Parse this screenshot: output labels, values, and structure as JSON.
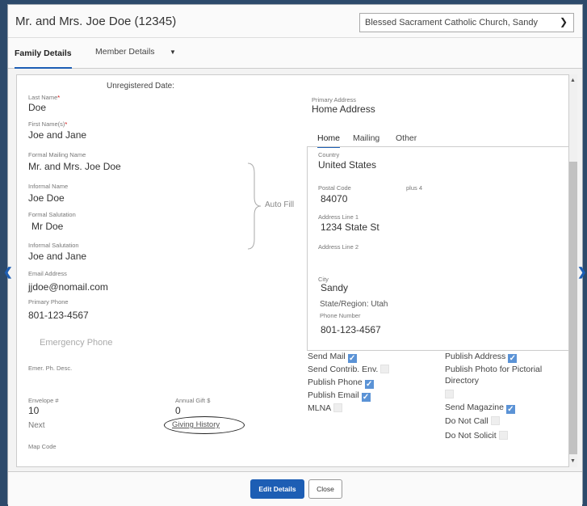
{
  "header": {
    "title": "Mr. and Mrs. Joe Doe (12345)",
    "church": "Blessed Sacrament Catholic Church, Sandy"
  },
  "tabs": {
    "family": "Family Details",
    "member": "Member Details"
  },
  "left": {
    "unregistered_label": "Unregistered Date:",
    "last_name_label": "Last Name",
    "last_name": "Doe",
    "first_name_label": "First Name(s)",
    "first_name": "Joe and Jane",
    "formal_mailing_label": "Formal Mailing Name",
    "formal_mailing": "Mr. and Mrs. Joe Doe",
    "informal_name_label": "Informal Name",
    "informal_name": "Joe Doe",
    "formal_salutation_label": "Formal Salutation",
    "formal_salutation": "Mr Doe",
    "informal_salutation_label": "Informal Salutation",
    "informal_salutation": "Joe and Jane",
    "email_label": "Email Address",
    "email": "jjdoe@nomail.com",
    "primary_phone_label": "Primary Phone",
    "primary_phone": "801-123-4567",
    "emergency_phone_placeholder": "Emergency Phone",
    "emer_desc_label": "Emer. Ph. Desc.",
    "envelope_label": "Envelope #",
    "envelope": "10",
    "annual_gift_label": "Annual Gift $",
    "annual_gift": "0",
    "next_label": "Next",
    "giving_history": "Giving History",
    "map_code_label": "Map Code",
    "auto_fill": "Auto Fill"
  },
  "address": {
    "primary_label": "Primary Address",
    "primary_value": "Home Address",
    "tabs": [
      "Home",
      "Mailing",
      "Other"
    ],
    "country_label": "Country",
    "country": "United States",
    "postal_label": "Postal Code",
    "plus4_label": "plus 4",
    "postal": "84070",
    "line1_label": "Address Line 1",
    "line1": "1234 State St",
    "line2_label": "Address Line 2",
    "city_label": "City",
    "city": "Sandy",
    "state_region": "State/Region: Utah",
    "phone_label": "Phone Number",
    "phone": "801-123-4567"
  },
  "checkboxes": {
    "send_mail": "Send Mail",
    "send_contrib": "Send Contrib. Env.",
    "publish_phone": "Publish Phone",
    "publish_email": "Publish Email",
    "mlna": "MLNA",
    "publish_address": "Publish Address",
    "publish_photo_1": "Publish Photo for Pictorial",
    "publish_photo_2": "Directory",
    "send_magazine": "Send Magazine",
    "do_not_call": "Do Not Call",
    "do_not_solicit": "Do Not Solicit"
  },
  "checkbox_states": {
    "send_mail": true,
    "send_contrib": false,
    "publish_phone": true,
    "publish_email": true,
    "mlna": false,
    "publish_address": true,
    "publish_photo": false,
    "send_magazine": true,
    "do_not_call": false,
    "do_not_solicit": false
  },
  "footer": {
    "edit": "Edit Details",
    "close": "Close"
  },
  "colors": {
    "accent": "#1d5eb4",
    "checkbox_on": "#5b93d6",
    "required": "#cc0000",
    "background": "#2d4a6b"
  },
  "icons": [
    "chevron-down-icon",
    "caret-down-icon",
    "chevron-left-icon",
    "chevron-right-icon",
    "scroll-up-icon",
    "scroll-down-icon",
    "checkmark-icon"
  ]
}
